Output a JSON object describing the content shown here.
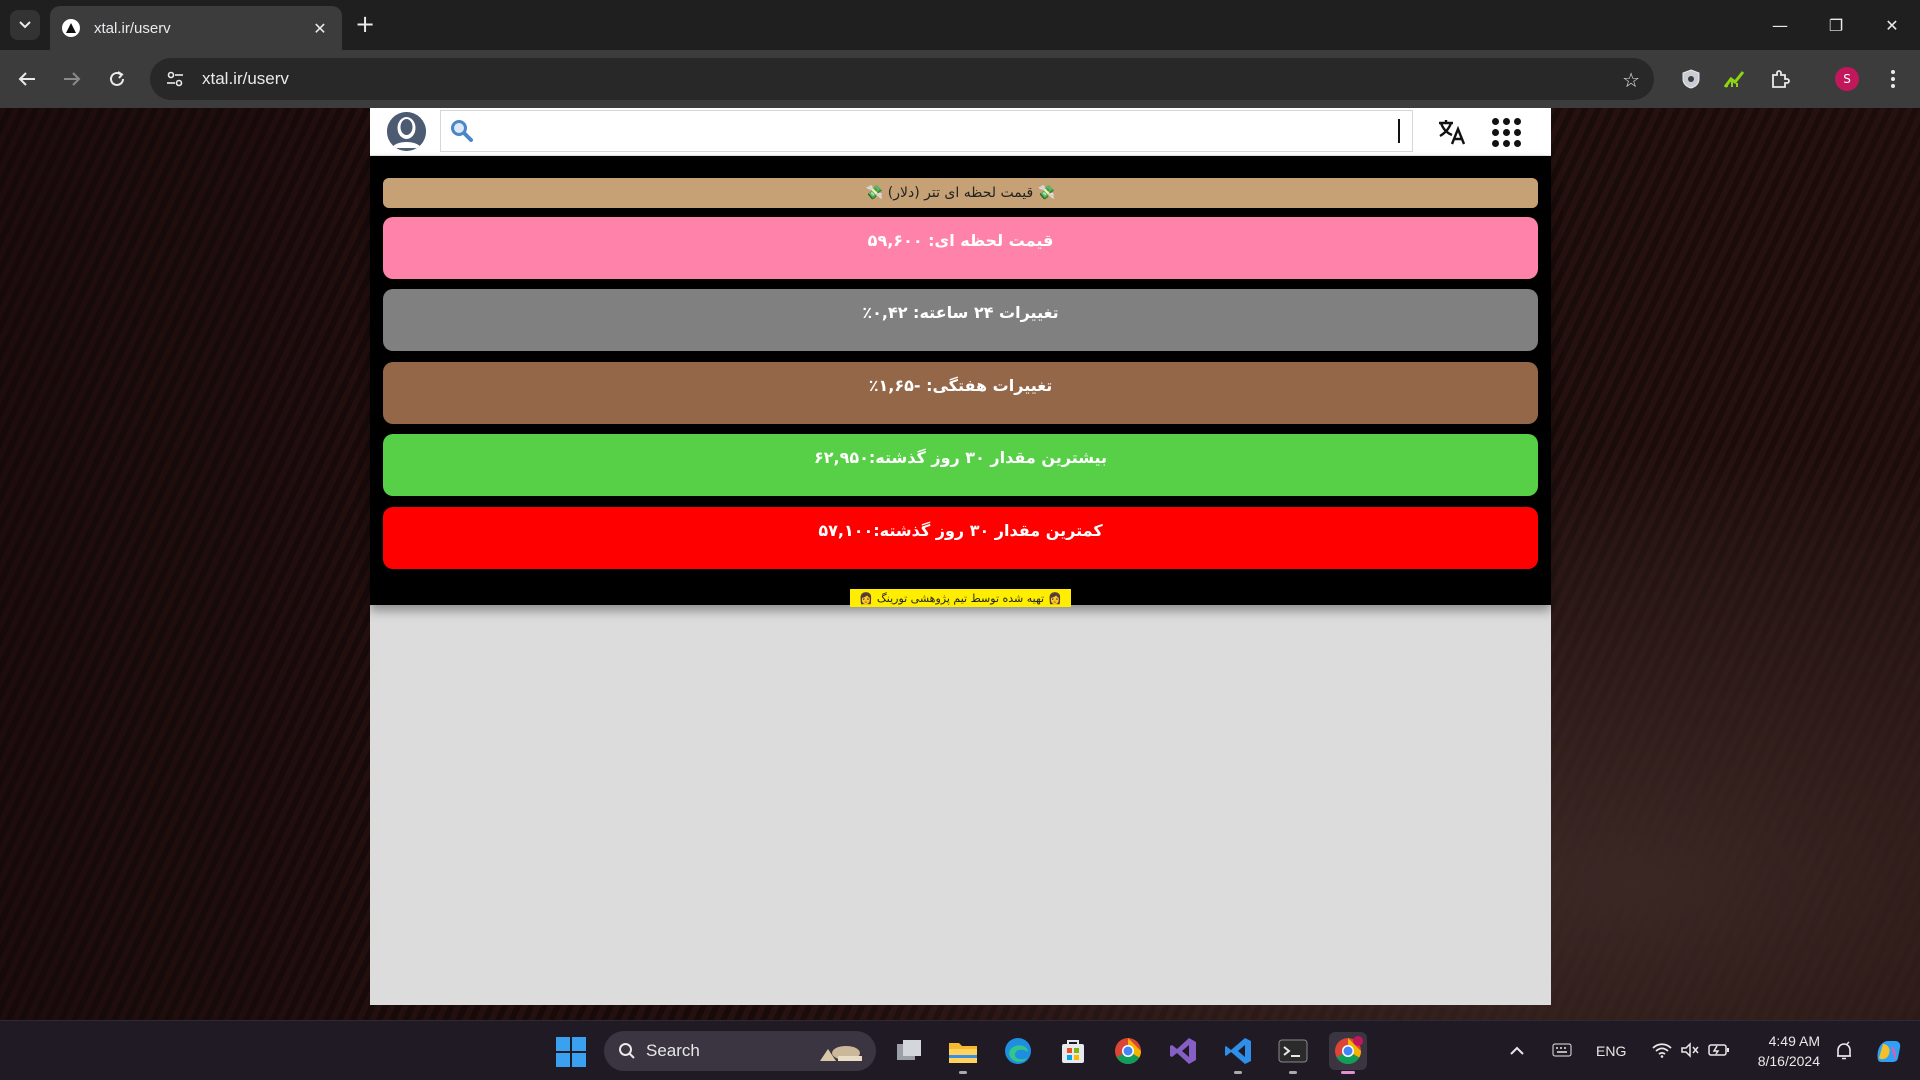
{
  "browser": {
    "tab_title": "xtal.ir/userv",
    "url": "xtal.ir/userv",
    "profile_initial": "S"
  },
  "app": {
    "search": {
      "placeholder": "",
      "value": ""
    },
    "panel_title": "💸 قیمت لحظه ای تتر (دلار) 💸",
    "stats": [
      {
        "text": "قیمت لحظه ای: ۵۹,۶۰۰",
        "color": "#ff82aa"
      },
      {
        "text": "تغییرات ۲۴ ساعته: ۰,۴۲٪",
        "color": "#808080"
      },
      {
        "text": "تغییرات هفتگی: -۱,۶۵٪",
        "color": "#946749"
      },
      {
        "text": "بیشترین مقدار ۳۰ روز گذشته:۶۲,۹۵۰",
        "color": "#57cf47"
      },
      {
        "text": "کمترین مقدار ۳۰ روز گذشته:۵۷,۱۰۰",
        "color": "#ff0000"
      }
    ],
    "footer_note": "تهیه شده توسط تیم پژوهشی تورینگ"
  },
  "taskbar": {
    "search_label": "Search",
    "language": "ENG",
    "time": "4:49 AM",
    "date": "8/16/2024"
  },
  "icons": {
    "search": "search-icon",
    "translate": "translate-icon",
    "apps": "apps-grid-icon",
    "user": "user-avatar-icon"
  }
}
